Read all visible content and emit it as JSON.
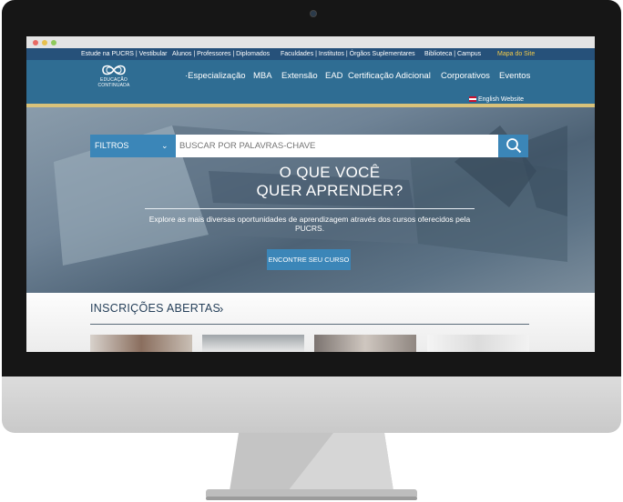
{
  "top_links": {
    "estude": "Estude na PUCRS | Vestibular",
    "alunos": "Alunos | Professores | Diplomados",
    "faculdades": "Faculdades | Institutos | Órgãos Suplementares",
    "biblioteca": "Biblioteca | Campus",
    "mapa": "Mapa do Site"
  },
  "logo": {
    "line1": "EDUCAÇÃO",
    "line2": "CONTINUADA"
  },
  "nav": [
    "·Especialização",
    "MBA",
    "Extensão",
    "EAD",
    "Certificação Adicional",
    "Corporativos",
    "Eventos"
  ],
  "english_link": "English Website",
  "search": {
    "filters_label": "FILTROS",
    "placeholder": "BUSCAR POR PALAVRAS-CHAVE"
  },
  "hero": {
    "headline_line1": "O QUE VOCÊ",
    "headline_line2": "QUER APRENDER?",
    "subtitle": "Explore as mais diversas oportunidades de aprendizagem através dos cursos oferecidos pela PUCRS.",
    "cta_label": "ENCONTRE SEU CURSO"
  },
  "section": {
    "title": "INSCRIÇÕES ABERTAS"
  },
  "colors": {
    "topbar": "#26517a",
    "navbar": "#2f6d93",
    "accent": "#3b86b8",
    "yellow": "#d9c27a"
  }
}
